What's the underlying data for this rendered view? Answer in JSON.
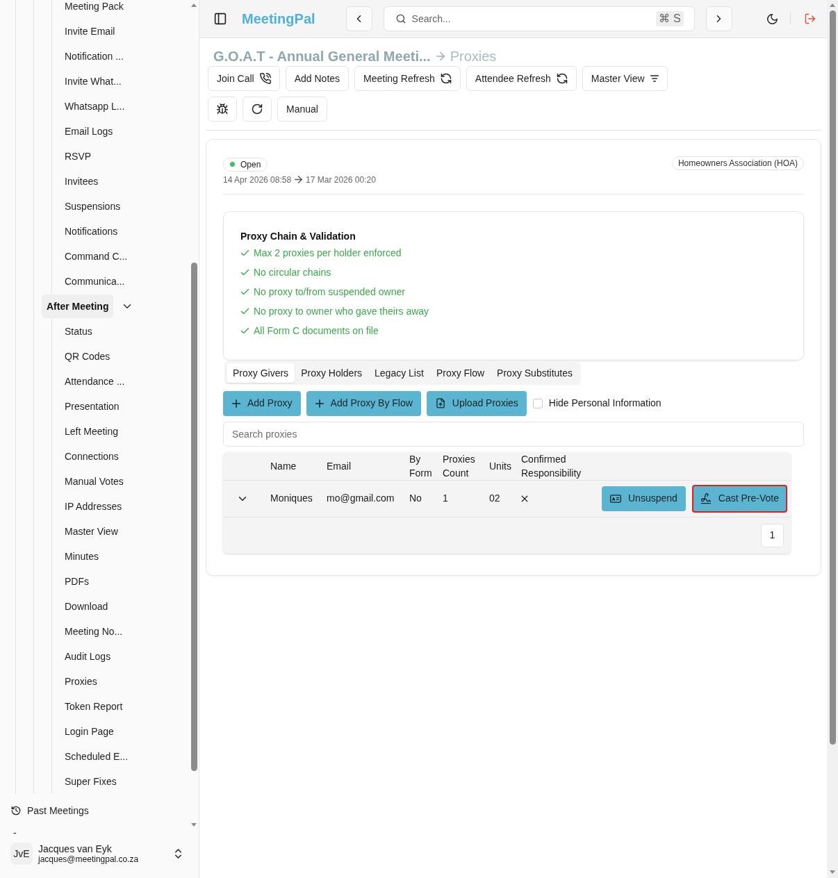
{
  "sidebar": {
    "groups": [
      {
        "children": [
          "Meeting Pack",
          "Invite Email",
          "Notification ...",
          "Invite What...",
          "Whatsapp L...",
          "Email Logs",
          "RSVP",
          "Invitees",
          "Suspensions",
          "Notifications",
          "Command C...",
          "Communica..."
        ]
      },
      {
        "label": "After Meeting",
        "expanded": true,
        "children": [
          "Status",
          "QR Codes",
          "Attendance ...",
          "Presentation",
          "Left Meeting",
          "Connections",
          "Manual Votes",
          "IP Addresses",
          "Master View",
          "Minutes",
          "PDFs",
          "Download",
          "Meeting No...",
          "Audit Logs",
          "Proxies",
          "Token Report",
          "Login Page",
          "Scheduled E...",
          "Super Fixes"
        ]
      }
    ],
    "past_meetings": "Past Meetings",
    "separator": "-",
    "user": {
      "initials": "JvE",
      "name": "Jacques van Eyk",
      "email": "jacques@meetingpal.co.za"
    }
  },
  "topbar": {
    "brand": "MeetingPal",
    "search": {
      "placeholder": "Search...",
      "shortcut": "⌘ S"
    }
  },
  "breadcrumb": {
    "title": "G.O.A.T - Annual General Meeti...",
    "current": "Proxies"
  },
  "toolbar": {
    "buttons": [
      "Join Call",
      "Add Notes",
      "Meeting Refresh",
      "Attendee Refresh",
      "Master View"
    ],
    "manual": "Manual"
  },
  "meeting": {
    "status": {
      "label": "Open",
      "color": "#3cc05a"
    },
    "start": "14 Apr 2026 08:58",
    "end": "17 Mar 2026 00:20",
    "type": "Homeowners Association (HOA)"
  },
  "validation": {
    "title": "Proxy Chain & Validation",
    "checks": [
      {
        "text": "Max 2 proxies per holder enforced",
        "passed": true
      },
      {
        "text": "No circular chains",
        "passed": true
      },
      {
        "text": "No proxy to/from suspended owner",
        "passed": true
      },
      {
        "text": "No proxy to owner who gave theirs away",
        "passed": true
      },
      {
        "text": "All Form C documents on file",
        "passed": true
      }
    ]
  },
  "tabs": [
    {
      "label": "Proxy Givers",
      "selected": true
    },
    {
      "label": "Proxy Holders",
      "selected": false
    },
    {
      "label": "Legacy List",
      "selected": false
    },
    {
      "label": "Proxy Flow",
      "selected": false
    },
    {
      "label": "Proxy Substitutes",
      "selected": false
    }
  ],
  "actions": {
    "buttons": [
      "Add Proxy",
      "Add Proxy By Flow",
      "Upload Proxies"
    ],
    "hide_personal": {
      "label": "Hide Personal Information",
      "checked": false
    }
  },
  "search_proxies": {
    "placeholder": "Search proxies"
  },
  "table": {
    "columns": [
      "Name",
      "Email",
      "By Form",
      "Proxies Count",
      "Units",
      "Confirmed Responsibility"
    ],
    "rows": [
      {
        "name": "Moniques",
        "email": "mo@gmail.com",
        "by_form": "No",
        "proxies_count": "1",
        "units": "02",
        "confirmed": false,
        "actions": [
          {
            "label": "Unsuspend",
            "focused": false
          },
          {
            "label": "Cast Pre-Vote",
            "focused": true
          }
        ]
      }
    ],
    "pages": [
      {
        "label": "1",
        "selected": true
      }
    ]
  }
}
